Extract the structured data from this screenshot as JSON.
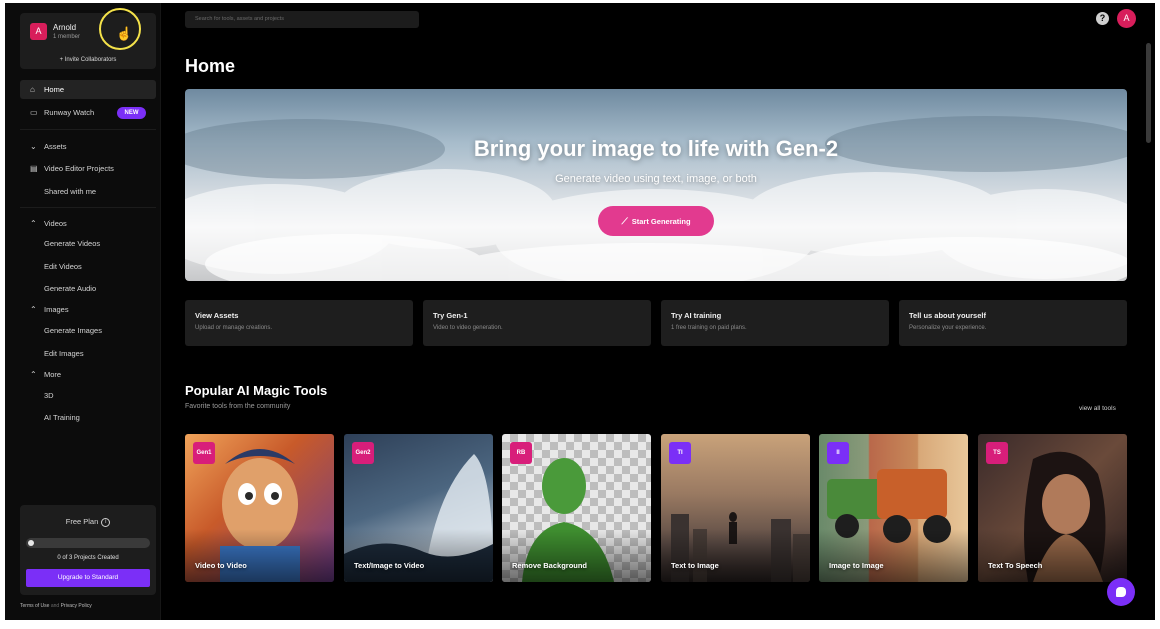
{
  "workspace": {
    "avatar_letter": "A",
    "name": "Arnold",
    "members": "1 member",
    "invite_label": "+ Invite Collaborators"
  },
  "sidebar": {
    "home": "Home",
    "runway_watch": "Runway Watch",
    "new_badge": "NEW",
    "assets": "Assets",
    "video_editor_projects": "Video Editor Projects",
    "shared_with_me": "Shared with me",
    "videos": "Videos",
    "generate_videos": "Generate Videos",
    "edit_videos": "Edit Videos",
    "generate_audio": "Generate Audio",
    "images": "Images",
    "generate_images": "Generate Images",
    "edit_images": "Edit Images",
    "more": "More",
    "three_d": "3D",
    "ai_training": "AI Training"
  },
  "plan": {
    "title": "Free Plan",
    "info_glyph": "i",
    "progress_fraction": 0,
    "progress_marker": "0",
    "projects_created": "0 of 3 Projects Created",
    "upgrade_label": "Upgrade to Standard"
  },
  "footer": {
    "terms": "Terms of Use",
    "and": "and",
    "privacy": "Privacy Policy"
  },
  "header": {
    "search_placeholder": "Search for tools, assets and projects",
    "help_glyph": "?",
    "user_avatar_letter": "A"
  },
  "page_title": "Home",
  "hero": {
    "title": "Bring your image to life with Gen-2",
    "subtitle": "Generate video using text, image, or both",
    "button": "Start Generating"
  },
  "quick_cards": [
    {
      "title": "View Assets",
      "subtitle": "Upload or manage creations."
    },
    {
      "title": "Try Gen-1",
      "subtitle": "Video to video generation."
    },
    {
      "title": "Try AI training",
      "subtitle": "1 free training on paid plans."
    },
    {
      "title": "Tell us about yourself",
      "subtitle": "Personalize your experience."
    }
  ],
  "tools_section": {
    "title": "Popular AI Magic Tools",
    "subtitle": "Favorite tools from the community",
    "view_all": "view all tools"
  },
  "tools": [
    {
      "tag": "Gen1",
      "name": "Video to Video",
      "tag_color": "#d81e7a"
    },
    {
      "tag": "Gen2",
      "name": "Text/Image to Video",
      "tag_color": "#d81e7a"
    },
    {
      "tag": "RB",
      "name": "Remove Background",
      "tag_color": "#d81e7a"
    },
    {
      "tag": "TI",
      "name": "Text to Image",
      "tag_color": "#7b2ff7"
    },
    {
      "tag": "II",
      "name": "Image to Image",
      "tag_color": "#7b2ff7"
    },
    {
      "tag": "TS",
      "name": "Text To Speech",
      "tag_color": "#d81e7a"
    }
  ],
  "colors": {
    "accent_purple": "#7b2ff7",
    "accent_pink": "#e23a8f",
    "avatar": "#d81e5b"
  }
}
